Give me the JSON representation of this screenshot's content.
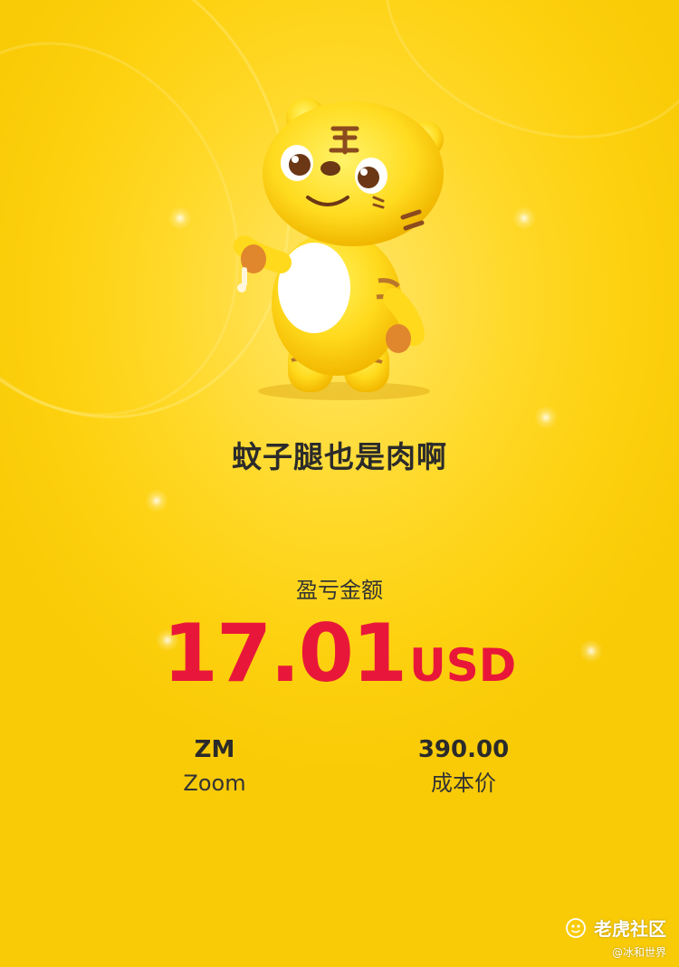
{
  "card": {
    "background_color": "#fdd10f",
    "mascot": "tiger-mascot-holding-drumsticks",
    "slogan": "蚊子腿也是肉啊",
    "pnl_label": "盈亏金额",
    "pnl_amount": "17.01",
    "pnl_currency": "USD",
    "pnl_color": "#e8173a",
    "stock": {
      "symbol": "ZM",
      "name": "Zoom"
    },
    "cost": {
      "value": "390.00",
      "label": "成本价"
    }
  },
  "watermark": {
    "icon": "tiger-community-logo-icon",
    "brand": "老虎社区",
    "user": "@冰和世界"
  }
}
